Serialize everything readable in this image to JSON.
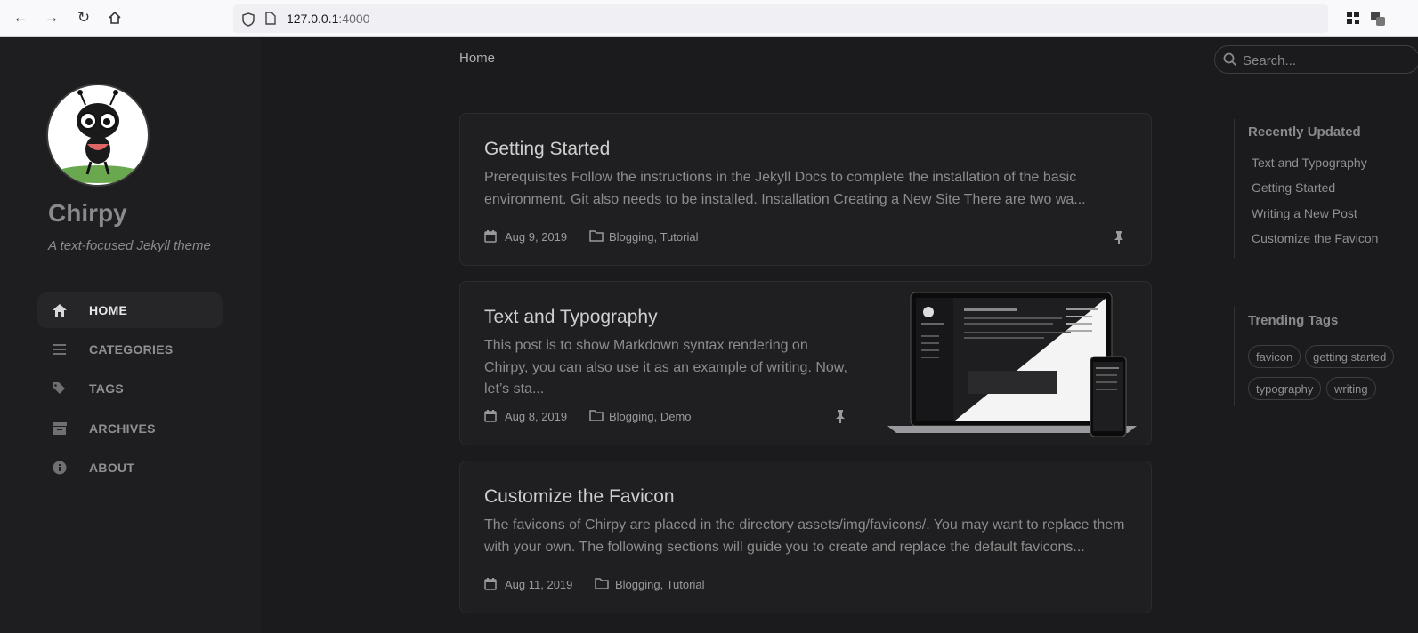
{
  "browser": {
    "url_host": "127.0.0.1",
    "url_port": ":4000"
  },
  "sidebar": {
    "site_title": "Chirpy",
    "site_subtitle": "A text-focused Jekyll theme",
    "nav": [
      {
        "label": "HOME",
        "icon": "home-icon"
      },
      {
        "label": "CATEGORIES",
        "icon": "list-icon"
      },
      {
        "label": "TAGS",
        "icon": "tags-icon"
      },
      {
        "label": "ARCHIVES",
        "icon": "archive-icon"
      },
      {
        "label": "ABOUT",
        "icon": "info-icon"
      }
    ]
  },
  "topbar": {
    "breadcrumb": "Home",
    "search_placeholder": "Search..."
  },
  "posts": [
    {
      "title": "Getting Started",
      "excerpt": "Prerequisites Follow the instructions in the Jekyll Docs to complete the installation of the basic environment. Git also needs to be installed. Installation Creating a New Site There are two wa...",
      "date": "Aug 9, 2019",
      "categories": "Blogging, Tutorial",
      "pinned": true
    },
    {
      "title": "Text and Typography",
      "excerpt": "This post is to show Markdown syntax rendering on Chirpy, you can also use it as an example of writing. Now, let’s sta...",
      "date": "Aug 8, 2019",
      "categories": "Blogging, Demo",
      "pinned": true
    },
    {
      "title": "Customize the Favicon",
      "excerpt": "The favicons of Chirpy are placed in the directory assets/img/favicons/. You may want to replace them with your own. The following sections will guide you to create and replace the default favicons...",
      "date": "Aug 11, 2019",
      "categories": "Blogging, Tutorial",
      "pinned": false
    }
  ],
  "panel": {
    "recent_title": "Recently Updated",
    "recent": [
      "Text and Typography",
      "Getting Started",
      "Writing a New Post",
      "Customize the Favicon"
    ],
    "tags_title": "Trending Tags",
    "tags": [
      "favicon",
      "getting started",
      "typography",
      "writing"
    ]
  },
  "colors": {
    "sidebar_bg": "#1e1e21",
    "page_bg": "#1b1b1e",
    "card_bg": "#1f1f22",
    "accent_text": "#cfcfcf"
  }
}
